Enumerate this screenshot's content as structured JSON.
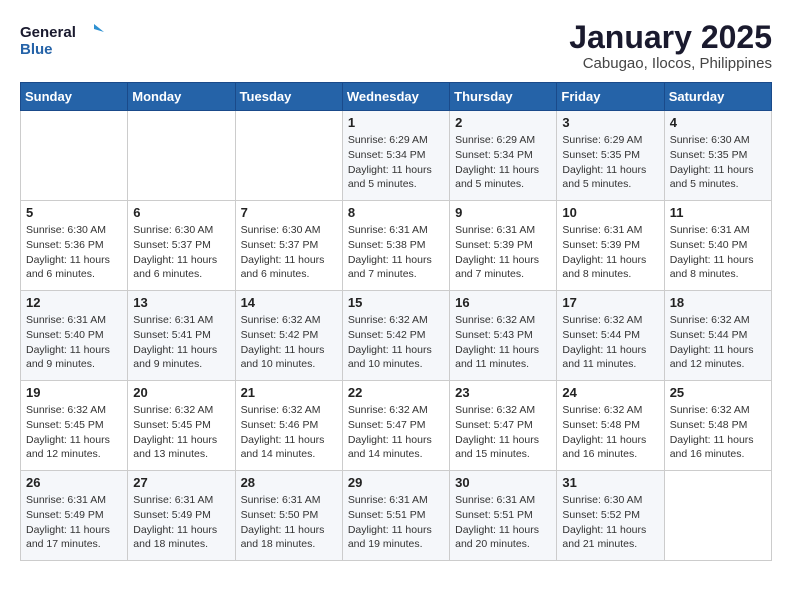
{
  "logo": {
    "line1": "General",
    "line2": "Blue"
  },
  "title": "January 2025",
  "subtitle": "Cabugao, Ilocos, Philippines",
  "weekdays": [
    "Sunday",
    "Monday",
    "Tuesday",
    "Wednesday",
    "Thursday",
    "Friday",
    "Saturday"
  ],
  "weeks": [
    [
      null,
      null,
      null,
      {
        "day": 1,
        "sunrise": "6:29 AM",
        "sunset": "5:34 PM",
        "daylight": "11 hours and 5 minutes."
      },
      {
        "day": 2,
        "sunrise": "6:29 AM",
        "sunset": "5:34 PM",
        "daylight": "11 hours and 5 minutes."
      },
      {
        "day": 3,
        "sunrise": "6:29 AM",
        "sunset": "5:35 PM",
        "daylight": "11 hours and 5 minutes."
      },
      {
        "day": 4,
        "sunrise": "6:30 AM",
        "sunset": "5:35 PM",
        "daylight": "11 hours and 5 minutes."
      }
    ],
    [
      {
        "day": 5,
        "sunrise": "6:30 AM",
        "sunset": "5:36 PM",
        "daylight": "11 hours and 6 minutes."
      },
      {
        "day": 6,
        "sunrise": "6:30 AM",
        "sunset": "5:37 PM",
        "daylight": "11 hours and 6 minutes."
      },
      {
        "day": 7,
        "sunrise": "6:30 AM",
        "sunset": "5:37 PM",
        "daylight": "11 hours and 6 minutes."
      },
      {
        "day": 8,
        "sunrise": "6:31 AM",
        "sunset": "5:38 PM",
        "daylight": "11 hours and 7 minutes."
      },
      {
        "day": 9,
        "sunrise": "6:31 AM",
        "sunset": "5:39 PM",
        "daylight": "11 hours and 7 minutes."
      },
      {
        "day": 10,
        "sunrise": "6:31 AM",
        "sunset": "5:39 PM",
        "daylight": "11 hours and 8 minutes."
      },
      {
        "day": 11,
        "sunrise": "6:31 AM",
        "sunset": "5:40 PM",
        "daylight": "11 hours and 8 minutes."
      }
    ],
    [
      {
        "day": 12,
        "sunrise": "6:31 AM",
        "sunset": "5:40 PM",
        "daylight": "11 hours and 9 minutes."
      },
      {
        "day": 13,
        "sunrise": "6:31 AM",
        "sunset": "5:41 PM",
        "daylight": "11 hours and 9 minutes."
      },
      {
        "day": 14,
        "sunrise": "6:32 AM",
        "sunset": "5:42 PM",
        "daylight": "11 hours and 10 minutes."
      },
      {
        "day": 15,
        "sunrise": "6:32 AM",
        "sunset": "5:42 PM",
        "daylight": "11 hours and 10 minutes."
      },
      {
        "day": 16,
        "sunrise": "6:32 AM",
        "sunset": "5:43 PM",
        "daylight": "11 hours and 11 minutes."
      },
      {
        "day": 17,
        "sunrise": "6:32 AM",
        "sunset": "5:44 PM",
        "daylight": "11 hours and 11 minutes."
      },
      {
        "day": 18,
        "sunrise": "6:32 AM",
        "sunset": "5:44 PM",
        "daylight": "11 hours and 12 minutes."
      }
    ],
    [
      {
        "day": 19,
        "sunrise": "6:32 AM",
        "sunset": "5:45 PM",
        "daylight": "11 hours and 12 minutes."
      },
      {
        "day": 20,
        "sunrise": "6:32 AM",
        "sunset": "5:45 PM",
        "daylight": "11 hours and 13 minutes."
      },
      {
        "day": 21,
        "sunrise": "6:32 AM",
        "sunset": "5:46 PM",
        "daylight": "11 hours and 14 minutes."
      },
      {
        "day": 22,
        "sunrise": "6:32 AM",
        "sunset": "5:47 PM",
        "daylight": "11 hours and 14 minutes."
      },
      {
        "day": 23,
        "sunrise": "6:32 AM",
        "sunset": "5:47 PM",
        "daylight": "11 hours and 15 minutes."
      },
      {
        "day": 24,
        "sunrise": "6:32 AM",
        "sunset": "5:48 PM",
        "daylight": "11 hours and 16 minutes."
      },
      {
        "day": 25,
        "sunrise": "6:32 AM",
        "sunset": "5:48 PM",
        "daylight": "11 hours and 16 minutes."
      }
    ],
    [
      {
        "day": 26,
        "sunrise": "6:31 AM",
        "sunset": "5:49 PM",
        "daylight": "11 hours and 17 minutes."
      },
      {
        "day": 27,
        "sunrise": "6:31 AM",
        "sunset": "5:49 PM",
        "daylight": "11 hours and 18 minutes."
      },
      {
        "day": 28,
        "sunrise": "6:31 AM",
        "sunset": "5:50 PM",
        "daylight": "11 hours and 18 minutes."
      },
      {
        "day": 29,
        "sunrise": "6:31 AM",
        "sunset": "5:51 PM",
        "daylight": "11 hours and 19 minutes."
      },
      {
        "day": 30,
        "sunrise": "6:31 AM",
        "sunset": "5:51 PM",
        "daylight": "11 hours and 20 minutes."
      },
      {
        "day": 31,
        "sunrise": "6:30 AM",
        "sunset": "5:52 PM",
        "daylight": "11 hours and 21 minutes."
      },
      null
    ]
  ]
}
